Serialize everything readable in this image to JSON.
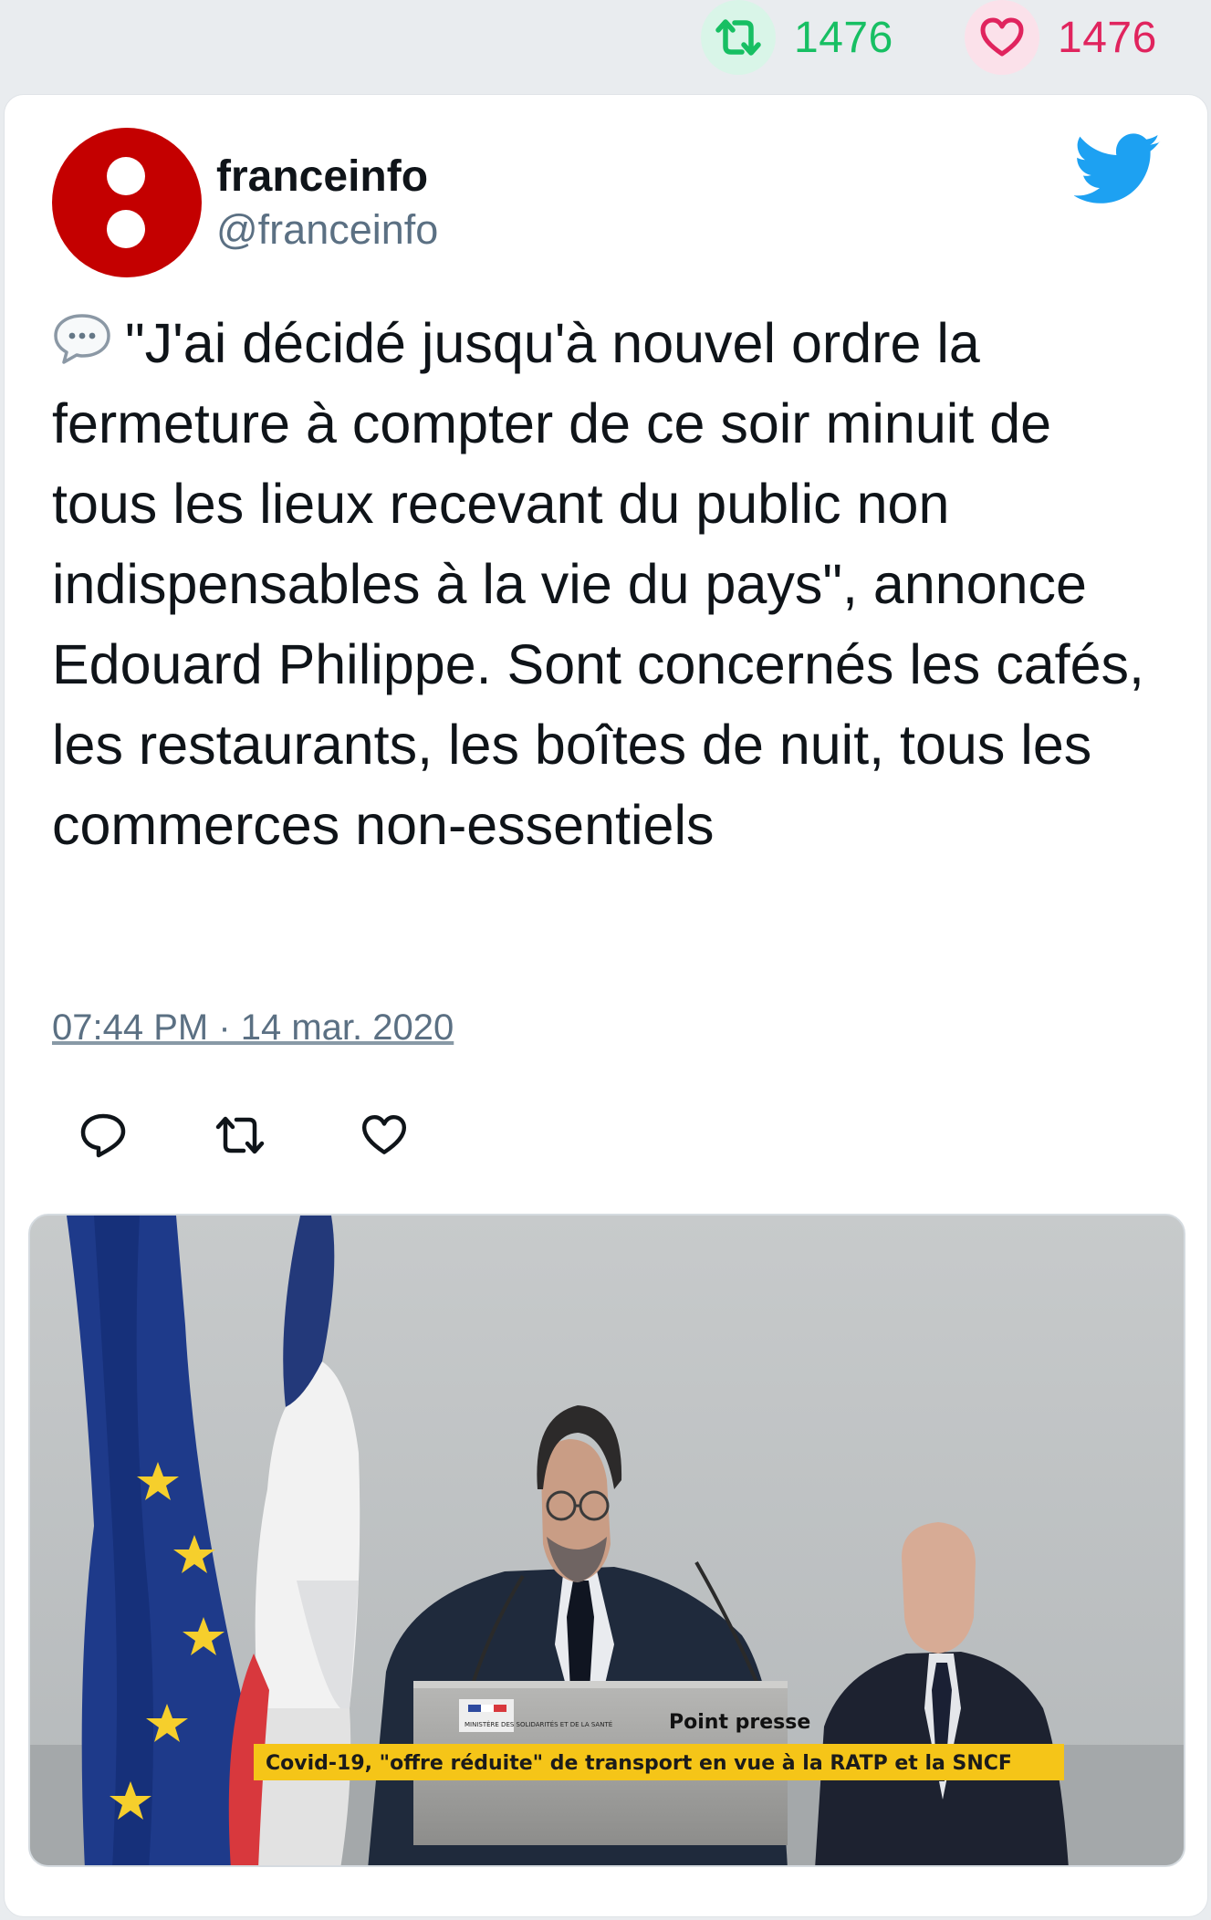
{
  "stats": {
    "retweet_count": "1476",
    "like_count": "1476",
    "retweet_color": "#17bf63",
    "like_color": "#e0245e"
  },
  "tweet": {
    "author_name": "franceinfo",
    "author_handle": "@franceinfo",
    "avatar_color": "#c40000",
    "brand_icon": "twitter-bird-icon",
    "text": "\"J'ai décidé jusqu'à nouvel ordre la fermeture à compter de ce soir minuit de tous les lieux recevant du public non indispensables à la vie du pays\", annonce Edouard Philippe. Sont concernés les cafés, les restaurants, les boîtes de nuit, tous les commerces non-essentiels",
    "lead_icon": "speech-balloon-icon",
    "timestamp": "07:44 PM · 14 mar. 2020"
  },
  "actions": {
    "icons": [
      "reply-icon",
      "retweet-icon",
      "like-icon"
    ]
  },
  "media": {
    "podium_label": "Point presse",
    "ministry_label": "MINISTÈRE DES SOLIDARITÉS ET DE LA SANTÉ",
    "chyron": "Covid-19, \"offre réduite\" de transport en vue à la RATP et la SNCF",
    "chyron_color": "#f5c518"
  }
}
